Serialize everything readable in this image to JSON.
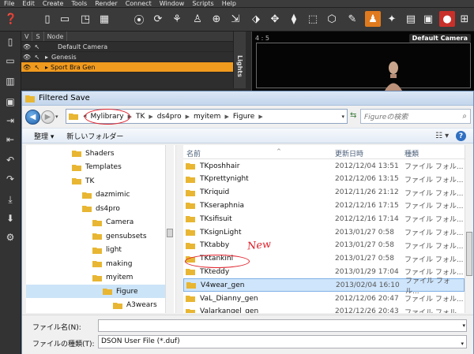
{
  "menubar": [
    "File",
    "Edit",
    "Create",
    "Tools",
    "Render",
    "Connect",
    "Window",
    "Scripts",
    "Help"
  ],
  "scene": {
    "columns": [
      "V",
      "S",
      "Node"
    ],
    "rows": [
      {
        "name": "Default Camera"
      },
      {
        "name": "Genesis"
      },
      {
        "name": "Sport Bra Gen",
        "selected": true
      }
    ],
    "side_tab": "Lights"
  },
  "viewport": {
    "ratio": "4 : 5",
    "camera": "Default Camera"
  },
  "dialog": {
    "title": "Filtered Save",
    "breadcrumb": [
      "«",
      "Mylibrary",
      "TK",
      "ds4pro",
      "myitem",
      "Figure"
    ],
    "search_placeholder": "Figureの検索",
    "organize": "整理 ▾",
    "new_folder": "新しいフォルダー",
    "tree": [
      {
        "label": "Shaders",
        "level": 0
      },
      {
        "label": "Templates",
        "level": 0
      },
      {
        "label": "TK",
        "level": 0
      },
      {
        "label": "dazmimic",
        "level": 1
      },
      {
        "label": "ds4pro",
        "level": 1
      },
      {
        "label": "Camera",
        "level": 2
      },
      {
        "label": "gensubsets",
        "level": 2
      },
      {
        "label": "light",
        "level": 2
      },
      {
        "label": "making",
        "level": 2
      },
      {
        "label": "myitem",
        "level": 2
      },
      {
        "label": "Figure",
        "level": 3,
        "selected": true
      },
      {
        "label": "A3wears",
        "level": 4
      }
    ],
    "columns": {
      "name": "名前",
      "date": "更新日時",
      "type": "種類"
    },
    "files": [
      {
        "name": "TKposhhair",
        "date": "2012/12/04 13:51",
        "type": "ファイル フォル..."
      },
      {
        "name": "TKprettynight",
        "date": "2012/12/06 13:15",
        "type": "ファイル フォル..."
      },
      {
        "name": "TKriquid",
        "date": "2012/11/26 21:12",
        "type": "ファイル フォル..."
      },
      {
        "name": "TKseraphnia",
        "date": "2012/12/16 17:15",
        "type": "ファイル フォル..."
      },
      {
        "name": "TKsifisuit",
        "date": "2012/12/16 17:14",
        "type": "ファイル フォル..."
      },
      {
        "name": "TKsignLight",
        "date": "2013/01/27 0:58",
        "type": "ファイル フォル..."
      },
      {
        "name": "TKtabby",
        "date": "2013/01/27 0:58",
        "type": "ファイル フォル..."
      },
      {
        "name": "TKtankini",
        "date": "2013/01/27 0:58",
        "type": "ファイル フォル..."
      },
      {
        "name": "TKteddy",
        "date": "2013/01/29 17:04",
        "type": "ファイル フォル..."
      },
      {
        "name": "V4wear_gen",
        "date": "2013/02/04 16:10",
        "type": "ファイル フォル...",
        "selected": true
      },
      {
        "name": "VaL_Dianny_gen",
        "date": "2012/12/06 20:47",
        "type": "ファイル フォル..."
      },
      {
        "name": "Valarkangel_gen",
        "date": "2012/12/26 20:43",
        "type": "ファイル フォル..."
      }
    ],
    "annotation": "New",
    "filename_label": "ファイル名(N):",
    "filename_value": "",
    "filetype_label": "ファイルの種類(T):",
    "filetype_value": "DSON User File (*.duf)"
  },
  "colors": {
    "folder": "#e8b632",
    "selection_orange": "#f09a1e",
    "annotation_red": "#e0202a",
    "dialog_accent": "#6f8fb8"
  }
}
